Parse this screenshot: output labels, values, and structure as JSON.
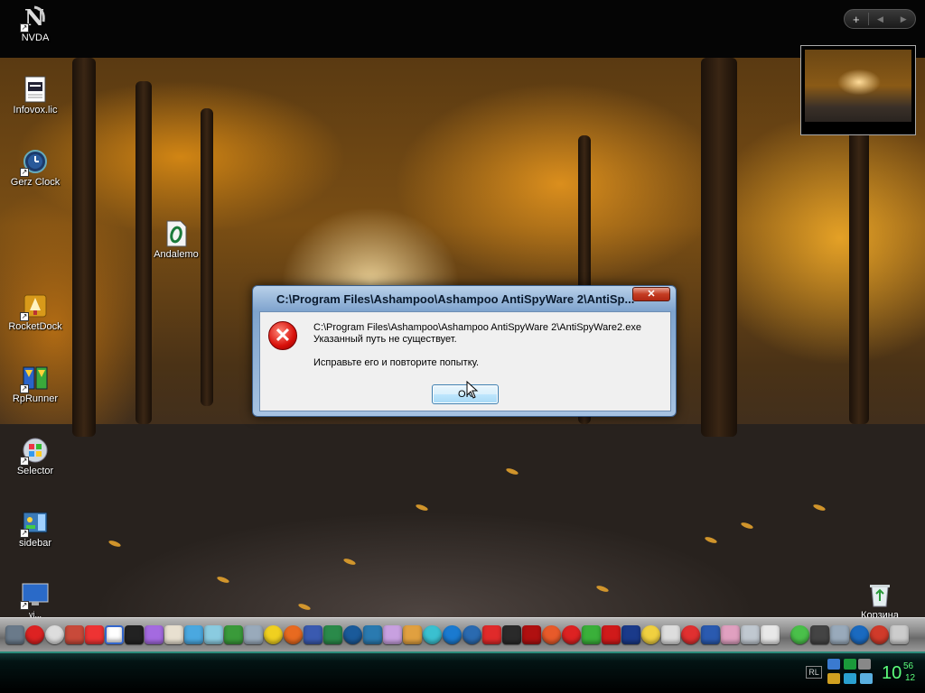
{
  "desktop": {
    "icons": [
      {
        "label": "NVDA",
        "icon": "nvda-icon"
      },
      {
        "label": "Infovox.lic",
        "icon": "text-file-icon"
      },
      {
        "label": "Gerz Clock",
        "icon": "clock-icon"
      },
      {
        "label": "Andalemo",
        "icon": "opera-file-icon"
      },
      {
        "label": "RocketDock",
        "icon": "rocketdock-icon"
      },
      {
        "label": "RpRunner",
        "icon": "rprunner-icon"
      },
      {
        "label": "Selector",
        "icon": "windows-logo-icon"
      },
      {
        "label": "sidebar",
        "icon": "sidebar-icon"
      },
      {
        "label": "vi...",
        "icon": "monitor-icon"
      },
      {
        "label": "Корзина",
        "icon": "recycle-bin-icon"
      }
    ]
  },
  "topbar": {
    "add_symbol": "+",
    "prev_symbol": "◀",
    "next_symbol": "▶"
  },
  "dialog": {
    "title": "C:\\Program Files\\Ashampoo\\Ashampoo AntiSpyWare 2\\AntiSp...",
    "close_symbol": "✕",
    "icon": "error-icon",
    "line1": "C:\\Program Files\\Ashampoo\\Ashampoo AntiSpyWare 2\\AntiSpyWare2.exe",
    "line2": "Указанный путь не существует.",
    "line3": "Исправьте его и повторите попытку.",
    "ok_label": "OK"
  },
  "taskbar": {
    "language": "RL",
    "clock_hour": "10",
    "clock_minute": "56",
    "clock_second": "12"
  },
  "colors": {
    "clock": "#5cff7c",
    "dialog_frame": "#8fb0d6",
    "error_red": "#d8100a"
  }
}
